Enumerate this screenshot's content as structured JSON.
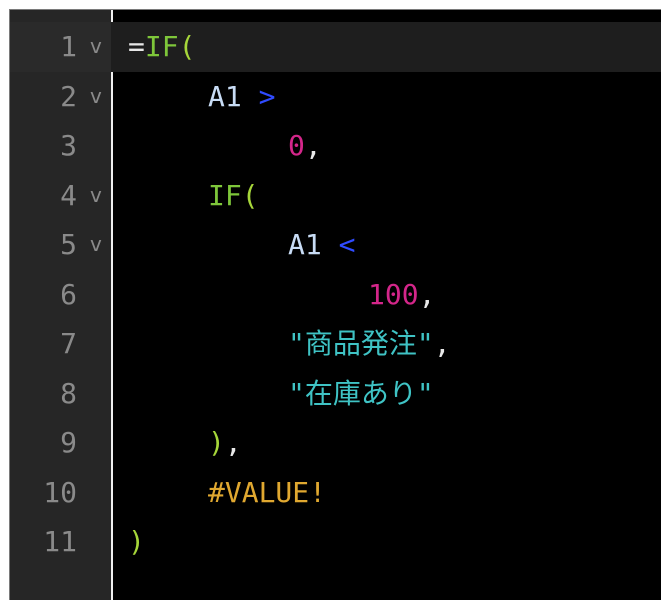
{
  "editor": {
    "current_line": 1,
    "fold_marker": "v",
    "colors": {
      "background": "#000000",
      "gutter": "#262626",
      "line_number": "#8a8a8a",
      "function": "#7ec63a",
      "reference": "#c8dcf5",
      "operator": "#2f4bff",
      "number": "#d4268a",
      "string": "#3fc3c5",
      "error": "#e0a830"
    },
    "lines": [
      {
        "number": "1",
        "fold": "v",
        "indent": 0,
        "tokens": [
          {
            "t": "op",
            "v": "="
          },
          {
            "t": "fn",
            "v": "IF"
          },
          {
            "t": "paren",
            "v": "("
          }
        ]
      },
      {
        "number": "2",
        "fold": "v",
        "indent": 4,
        "tokens": [
          {
            "t": "ref",
            "v": "A1"
          },
          {
            "t": "sp",
            "v": " "
          },
          {
            "t": "cmp",
            "v": ">"
          }
        ]
      },
      {
        "number": "3",
        "fold": "",
        "indent": 8,
        "tokens": [
          {
            "t": "num",
            "v": "0"
          },
          {
            "t": "punct",
            "v": ","
          }
        ]
      },
      {
        "number": "4",
        "fold": "v",
        "indent": 4,
        "tokens": [
          {
            "t": "fn",
            "v": "IF"
          },
          {
            "t": "paren",
            "v": "("
          }
        ]
      },
      {
        "number": "5",
        "fold": "v",
        "indent": 8,
        "tokens": [
          {
            "t": "ref",
            "v": "A1"
          },
          {
            "t": "sp",
            "v": " "
          },
          {
            "t": "cmp",
            "v": "<"
          }
        ]
      },
      {
        "number": "6",
        "fold": "",
        "indent": 12,
        "tokens": [
          {
            "t": "num",
            "v": "100"
          },
          {
            "t": "punct",
            "v": ","
          }
        ]
      },
      {
        "number": "7",
        "fold": "",
        "indent": 8,
        "tokens": [
          {
            "t": "str",
            "v": "\"商品発注\""
          },
          {
            "t": "punct",
            "v": ","
          }
        ]
      },
      {
        "number": "8",
        "fold": "",
        "indent": 8,
        "tokens": [
          {
            "t": "str",
            "v": "\"在庫あり\""
          }
        ]
      },
      {
        "number": "9",
        "fold": "",
        "indent": 4,
        "tokens": [
          {
            "t": "paren",
            "v": ")"
          },
          {
            "t": "punct",
            "v": ","
          }
        ]
      },
      {
        "number": "10",
        "fold": "",
        "indent": 4,
        "tokens": [
          {
            "t": "err",
            "v": "#VALUE!"
          }
        ]
      },
      {
        "number": "11",
        "fold": "",
        "indent": 0,
        "tokens": [
          {
            "t": "paren",
            "v": ")"
          }
        ]
      }
    ]
  }
}
